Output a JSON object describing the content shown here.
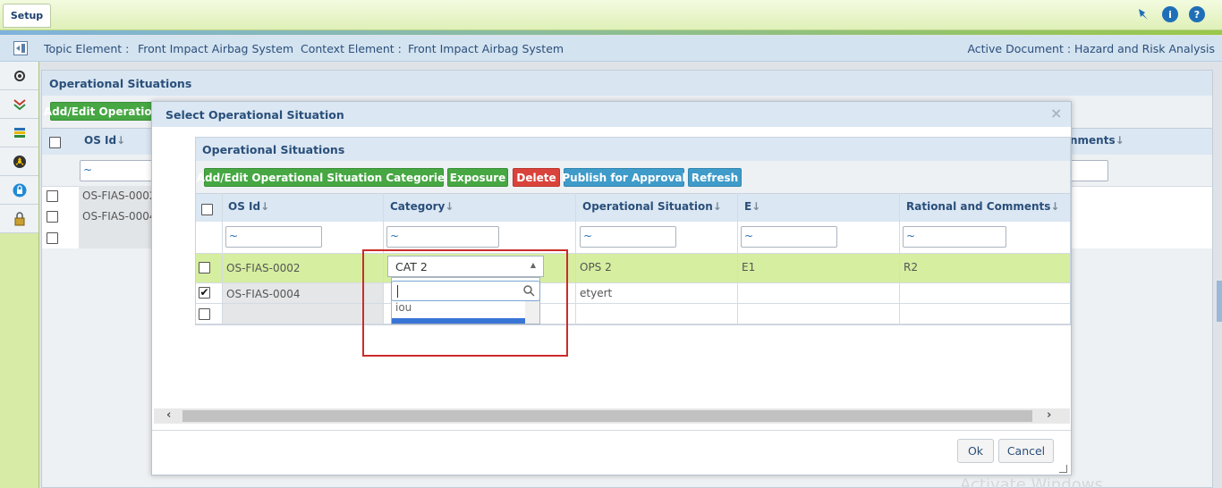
{
  "topbar": {
    "tab_label": "Setup"
  },
  "context": {
    "topic_label": "Topic Element :",
    "topic_value": "Front Impact Airbag System",
    "context_label": "Context Element :",
    "context_value": "Front Impact Airbag System",
    "active_doc": "Active Document : Hazard and Risk Analysis"
  },
  "background": {
    "title": "Operational Situations",
    "add_button": "Add/Edit Operation",
    "col_os_id": "OS Id",
    "col_comments": "nments",
    "filter": "~",
    "rows": [
      "OS-FIAS-0002",
      "OS-FIAS-0004"
    ]
  },
  "modal": {
    "title": "Select Operational Situation",
    "close": "×",
    "inner_title": "Operational Situations",
    "buttons": {
      "add_edit": "Add/Edit Operational Situation Categories",
      "exposure": "Exposure",
      "delete": "Delete",
      "publish": "Publish for Approval",
      "refresh": "Refresh"
    },
    "columns": [
      "OS Id",
      "Category",
      "Operational Situation",
      "E",
      "Rational and Comments"
    ],
    "filter": "~",
    "rows": [
      {
        "id": "OS-FIAS-0002",
        "category": "CAT 2",
        "situation": "OPS 2",
        "e": "E1",
        "rational": "R2",
        "checked": false
      },
      {
        "id": "OS-FIAS-0004",
        "category": "",
        "situation": "etyert",
        "e": "",
        "rational": "",
        "checked": true
      },
      {
        "id": "",
        "category": "",
        "situation": "",
        "e": "",
        "rational": "",
        "checked": false
      }
    ],
    "dropdown": {
      "selected": "CAT 2",
      "option_partial": "iou"
    },
    "ok": "Ok",
    "cancel": "Cancel"
  },
  "watermark": "Activate Windows",
  "colors": {
    "green": "#46a743",
    "red": "#d9433b",
    "blue": "#3f9bc9",
    "highlight_row": "#d6eea0",
    "title_text": "#2a4f7a"
  }
}
